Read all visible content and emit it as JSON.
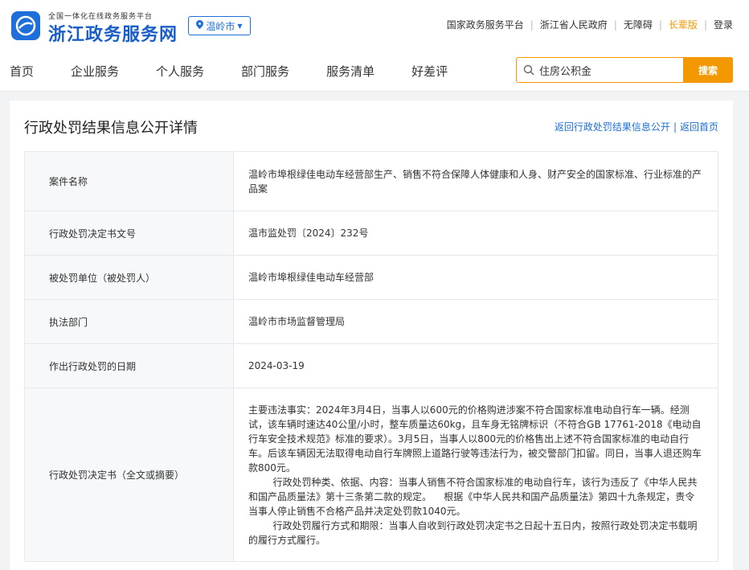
{
  "header": {
    "logo_sub": "全国一体化在线政务服务平台",
    "logo_main": "浙江政务服务网",
    "city": "温岭市",
    "links": [
      "国家政务服务平台",
      "浙江省人民政府",
      "无障碍",
      "长辈版",
      "登录"
    ],
    "accent": "#f39800",
    "brand": "#1e6fd9"
  },
  "nav": {
    "items": [
      "首页",
      "企业服务",
      "个人服务",
      "部门服务",
      "服务清单",
      "好差评"
    ]
  },
  "search": {
    "value": "住房公积金",
    "button": "搜索"
  },
  "panel": {
    "title": "行政处罚结果信息公开详情",
    "link_back_list": "返回行政处罚结果信息公开",
    "link_home": "返回首页"
  },
  "rows": [
    {
      "label": "案件名称",
      "value": "温岭市埠根绿佳电动车经营部生产、销售不符合保障人体健康和人身、财产安全的国家标准、行业标准的产品案"
    },
    {
      "label": "行政处罚决定书文号",
      "value": "温市监处罚〔2024〕232号"
    },
    {
      "label": "被处罚单位（被处罚人）",
      "value": "温岭市埠根绿佳电动车经营部"
    },
    {
      "label": "执法部门",
      "value": "温岭市市场监督管理局"
    },
    {
      "label": "作出行政处罚的日期",
      "value": "2024-03-19"
    },
    {
      "label": "行政处罚决定书（全文或摘要）",
      "paragraphs": [
        "主要违法事实：2024年3月4日，当事人以600元的价格购进涉案不符合国家标准电动自行车一辆。经测试，该车辆时速达40公里/小时，整车质量达60kg，且车身无铭牌标识（不符合GB 17761-2018《电动自行车安全技术规范》标准的要求）。3月5日，当事人以800元的价格售出上述不符合国家标准的电动自行车。后该车辆因无法取得电动自行车牌照上道路行驶等违法行为，被交警部门扣留。同日，当事人退还购车款800元。",
        "        行政处罚种类、依据、内容：当事人销售不符合国家标准的电动自行车，该行为违反了《中华人民共和国产品质量法》第十三条第二款的规定。    根据《中华人民共和国产品质量法》第四十九条规定，责令当事人停止销售不合格产品并决定处罚款1040元。",
        "        行政处罚履行方式和期限：当事人自收到行政处罚决定书之日起十五日内，按照行政处罚决定书载明的履行方式履行。"
      ]
    }
  ]
}
